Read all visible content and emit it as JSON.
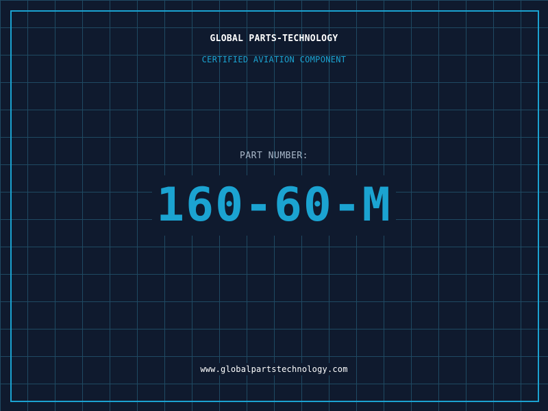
{
  "company_name": "GLOBAL PARTS-TECHNOLOGY",
  "subtitle": "CERTIFIED AVIATION COMPONENT",
  "part_label": "PART NUMBER:",
  "part_number": "160-60-M",
  "website": "www.globalpartstechnology.com",
  "colors": {
    "background": "#0f1a2e",
    "grid": "#1f4a63",
    "accent": "#1ba3d1",
    "text_primary": "#ffffff",
    "text_muted": "#a9b8c9"
  }
}
